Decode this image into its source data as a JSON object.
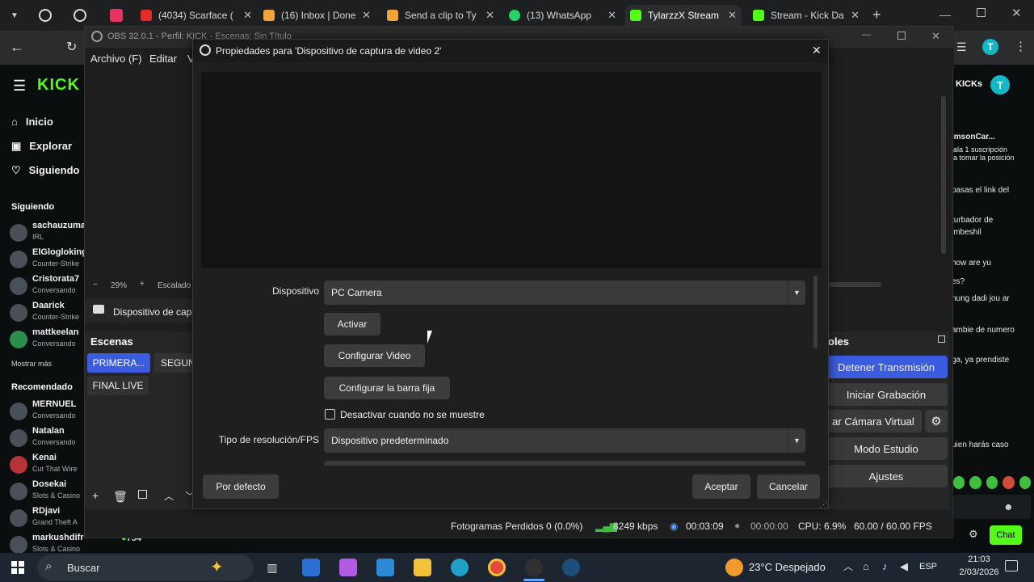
{
  "browser": {
    "tabs": [
      {
        "label": "(4034) Scarface (",
        "color": "#e52d27",
        "icon": "youtube-icon"
      },
      {
        "label": "(16) Inbox | Done",
        "color": "#f2a43a",
        "icon": "mail-icon"
      },
      {
        "label": "Send a clip to Ty",
        "color": "#f2a43a",
        "icon": "clip-icon"
      },
      {
        "label": "(13) WhatsApp",
        "color": "#25d366",
        "icon": "whatsapp-icon"
      },
      {
        "label": "TylarzzX Stream",
        "color": "#53fc18",
        "icon": "kick-icon"
      },
      {
        "label": "Stream - Kick Da",
        "color": "#53fc18",
        "icon": "kick-icon"
      }
    ]
  },
  "kick": {
    "logo": "KICK",
    "nav": [
      {
        "label": "Inicio",
        "icon": "home-icon"
      },
      {
        "label": "Explorar",
        "icon": "explore-icon"
      },
      {
        "label": "Siguiendo",
        "icon": "heart-icon"
      }
    ],
    "following_title": "Siguiendo",
    "following": [
      {
        "name": "sachauzuma",
        "cat": "IRL"
      },
      {
        "name": "ElGlogloking",
        "cat": "Counter-Strike"
      },
      {
        "name": "Cristorata7",
        "cat": "Conversando"
      },
      {
        "name": "Daarick",
        "cat": "Counter-Strike"
      },
      {
        "name": "mattkeelan",
        "cat": "Conversando"
      }
    ],
    "show_more": "Mostrar más",
    "recommended_title": "Recomendado",
    "recommended": [
      {
        "name": "MERNUEL",
        "cat": "Conversando"
      },
      {
        "name": "Natalan",
        "cat": "Conversando"
      },
      {
        "name": "Kenai",
        "cat": "Cut That Wire"
      },
      {
        "name": "Dosekai",
        "cat": "Slots & Casino"
      },
      {
        "name": "RDjavi",
        "cat": "Grand Theft A"
      },
      {
        "name": "markushdifr",
        "cat": "Slots & Casino"
      }
    ],
    "kicks_label": "KICKs",
    "chat_lines": [
      "imsonCar...",
      "jala 1 suscripción",
      "la tomar la posición",
      "pasas el link del",
      "turbador de",
      "imbeshil",
      "how are yu",
      "es?",
      "nung dadi jou ar",
      "ambie de numero",
      "ga, ya prendiste",
      "uien harás caso"
    ],
    "chat_button": "Chat",
    "viewer_count": "754"
  },
  "obs": {
    "title": "OBS 32.0.1 - Perfil: KICK - Escenas: Sin Título",
    "menu": [
      "Archivo (F)",
      "Editar",
      "V"
    ],
    "zoom": "29%",
    "scaling_label": "Escalado",
    "source_label": "Dispositivo de cap",
    "scenes_title": "Escenas",
    "scenes": [
      "PRIMERA...",
      "SEGUN",
      "FINAL LIVE"
    ],
    "controls_title": "oles",
    "controls": [
      "Detener Transmisión",
      "Iniciar Grabación",
      "ar Cámara Virtual",
      "Modo Estudio",
      "Ajustes"
    ],
    "status": {
      "frames_dropped": "Fotogramas Perdidos 0 (0.0%)",
      "bitrate": "8249 kbps",
      "stream_time": "00:03:09",
      "rec_time": "00:00:00",
      "cpu": "CPU: 6.9%",
      "fps": "60.00 / 60.00 FPS"
    }
  },
  "dialog": {
    "title": "Propiedades para 'Dispositivo de captura de video 2'",
    "device_label": "Dispositivo",
    "device_value": "PC Camera",
    "activate": "Activar",
    "configure_video": "Configurar Video",
    "configure_crossbar": "Configurar la barra fija",
    "deactivate_checkbox": "Desactivar cuando no se muestre",
    "resolution_label": "Tipo de resolución/FPS",
    "resolution_value": "Dispositivo predeterminado",
    "defaults_button": "Por defecto",
    "ok_button": "Aceptar",
    "cancel_button": "Cancelar"
  },
  "taskbar": {
    "search_placeholder": "Buscar",
    "weather": "23°C  Despejado",
    "language": "ESP",
    "time": "21:03",
    "date": "2/03/2026"
  }
}
